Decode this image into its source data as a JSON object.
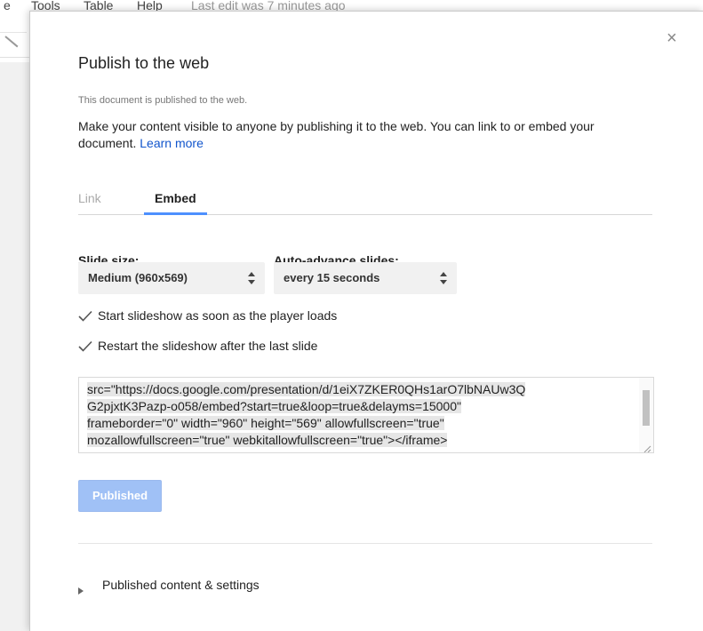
{
  "background": {
    "menu": [
      "e",
      "Tools",
      "Table",
      "Help"
    ],
    "last_edit": "Last edit was 7 minutes ago"
  },
  "dialog": {
    "close_glyph": "×",
    "title": "Publish to the web",
    "status": "This document is published to the web.",
    "description": "Make your content visible to anyone by publishing it to the web. You can link to or embed your document.",
    "learn_more": "Learn more",
    "tabs": [
      {
        "label": "Link",
        "active": false
      },
      {
        "label": "Embed",
        "active": true
      }
    ],
    "slide_size": {
      "label": "Slide size:",
      "value": "Medium (960x569)"
    },
    "auto_advance": {
      "label": "Auto-advance slides:",
      "value": "every 15 seconds"
    },
    "checkboxes": [
      {
        "label": "Start slideshow as soon as the player loads",
        "checked": true
      },
      {
        "label": "Restart the slideshow after the last slide",
        "checked": true
      }
    ],
    "embed_code": [
      "src=\"https://docs.google.com/presentation/d/1eiX7ZKER0QHs1arO7lbNAUw3Q",
      "G2pjxtK3Pazp-o058/embed?start=true&loop=true&delayms=15000\"",
      "frameborder=\"0\" width=\"960\" height=\"569\" allowfullscreen=\"true\"",
      "mozallowfullscreen=\"true\" webkitallowfullscreen=\"true\"></iframe>"
    ],
    "published_button": "Published",
    "published_settings": "Published content & settings"
  },
  "colors": {
    "accent": "#4d90fe",
    "link": "#1155cc",
    "button_disabled": "#a0c1f6"
  }
}
